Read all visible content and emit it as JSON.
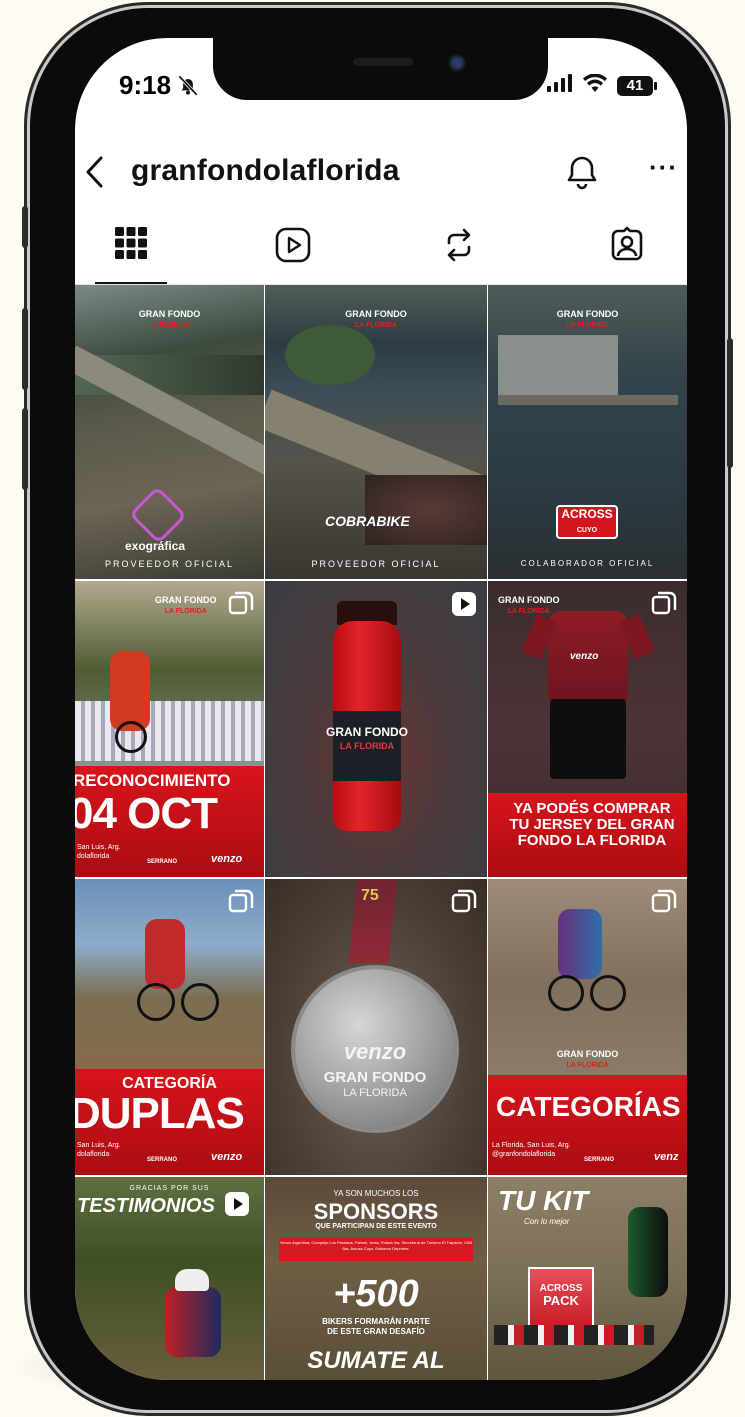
{
  "status": {
    "time": "9:18",
    "battery": "41"
  },
  "profile": {
    "username": "granfondolaflorida"
  },
  "tabs": [
    {
      "icon": "grid-icon",
      "active": true
    },
    {
      "icon": "reels-icon",
      "active": false
    },
    {
      "icon": "reposts-icon",
      "active": false
    },
    {
      "icon": "tagged-icon",
      "active": false
    }
  ],
  "posts": {
    "p1": {
      "logo": "GRAN FONDO",
      "logo_sub": "LA FLORIDA",
      "brand": "exográfica",
      "caption": "PROVEEDOR OFICIAL"
    },
    "p2": {
      "logo": "GRAN FONDO",
      "logo_sub": "LA FLORIDA",
      "brand": "COBRABIKE",
      "caption": "PROVEEDOR OFICIAL"
    },
    "p3": {
      "logo": "GRAN FONDO",
      "logo_sub": "LA FLORIDA",
      "brand": "ACROSS",
      "brand_sub": "CUYO",
      "caption": "COLABORADOR OFICIAL"
    },
    "p4": {
      "logo": "GRAN FONDO",
      "logo_sub": "LA FLORIDA",
      "line1": "RECONOCIMIENTO",
      "line2": "04 OCT",
      "place": "San Luis, Arg.",
      "handle": "dolaflorida",
      "brand1": "SERRANO",
      "brand2": "venzo"
    },
    "p5": {
      "logo": "GRAN FONDO",
      "logo_sub": "LA FLORIDA"
    },
    "p6": {
      "logo": "GRAN FONDO",
      "logo_sub": "LA FLORIDA",
      "jersey_brand": "venzo",
      "line1": "YA PODÉS COMPRAR",
      "line2": "TU JERSEY DEL GRAN",
      "line3": "FONDO LA FLORIDA"
    },
    "p7": {
      "line1": "CATEGORÍA",
      "line2": "DUPLAS",
      "place": "San Luis, Arg.",
      "handle": "dolaflorida",
      "brand1": "SERRANO",
      "brand2": "venzo"
    },
    "p8": {
      "ribbon": "75",
      "brand": "venzo",
      "line1": "GRAN FONDO",
      "line2": "LA FLORIDA"
    },
    "p9": {
      "logo": "GRAN FONDO",
      "logo_sub": "LA FLORIDA",
      "line1": "CATEGORÍAS",
      "place": "La Florida, San Luis, Arg.",
      "handle": "@granfondolaflorida",
      "brand1": "SERRANO",
      "brand2": "venz"
    },
    "p10": {
      "small": "GRACIAS POR SUS",
      "line1": "TESTIMONIOS"
    },
    "p11": {
      "small": "YA SON MUCHOS LOS",
      "line1": "SPONSORS",
      "line2": "QUE PARTICIPAN DE ESTE EVENTO",
      "band": "Venzo Argentina, Complejo Los Paraísos, Fahuel, Ivess, Futura Ina, Secretaría de Turismo El Trapiche, Chill Bar, Across Cuyo, Esfuerzo Deportes.",
      "big": "+500",
      "line3": "BIKERS FORMARÁN PARTE",
      "line4": "DE ESTE GRAN DESAFÍO",
      "line5": "SUMATE AL"
    },
    "p12": {
      "line1": "TU KIT",
      "line2": "Con lo mejor",
      "pack1": "ACROSS",
      "pack2": "PACK"
    }
  }
}
